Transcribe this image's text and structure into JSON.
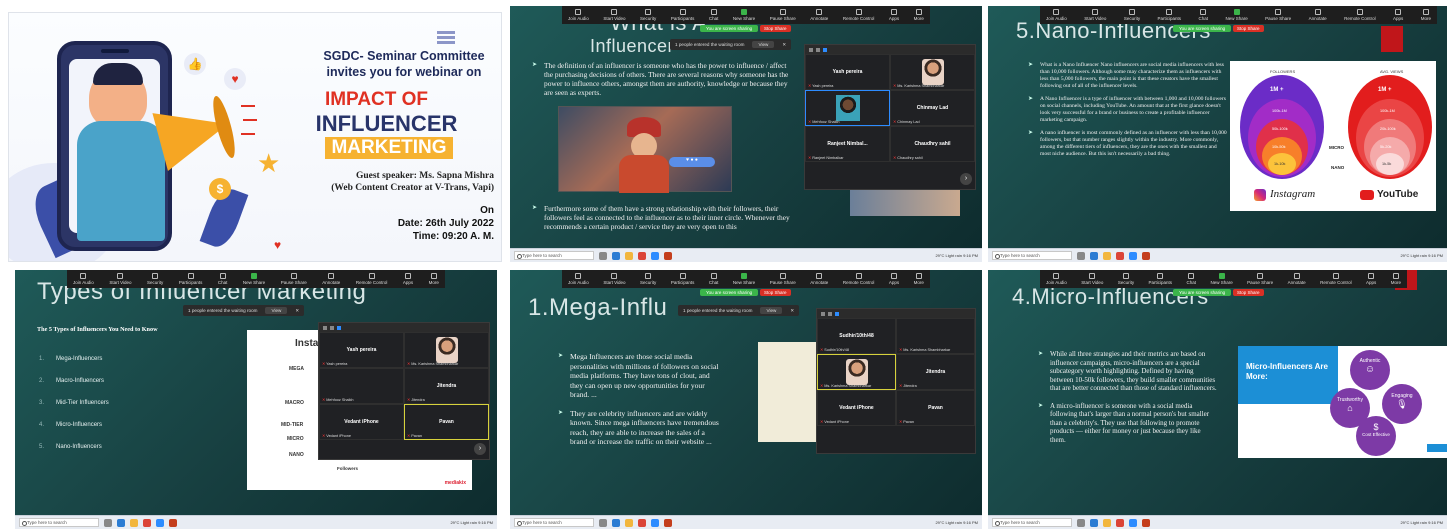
{
  "poster": {
    "line1": "SGDC- Seminar Committee",
    "line2": "invites you for webinar on",
    "title1": "IMPACT OF",
    "title2": "INFLUENCER",
    "title3": "MARKETING",
    "speaker": "Guest speaker:  Ms. Sapna Mishra",
    "speaker_role": "(Web Content Creator at V-Trans, Vapi)",
    "on_label": "On",
    "date": "Date: 26th July 2022",
    "time": "Time: 09:20 A. M."
  },
  "zoom_toolbar": {
    "items": [
      "Join Audio",
      "Start Video",
      "Security",
      "Participants",
      "Chat",
      "New Share",
      "Pause Share",
      "Annotate",
      "Remote Control",
      "Apps",
      "More"
    ],
    "sharing_label": "You are screen sharing",
    "stop_label": "Stop Share"
  },
  "waiting_room": {
    "text": "1 people entered the waiting room",
    "view": "View"
  },
  "taskbar": {
    "search": "Type here to search",
    "weather": "29°C  Light rain",
    "time": "9:16 PM",
    "date": "7/26/2022",
    "lang": "ENG\nIN"
  },
  "slide2": {
    "title": "What is A",
    "title_b": "Influencer",
    "b1": "The definition of an influencer is someone who has the power to influence / affect the purchasing decisions of others. There are several reasons why someone has the power to influence others, amongst them are authority, knowledge or because they are seen as experts.",
    "b2": "Furthermore some of them have a strong relationship with their followers, their followers feel as connected to the influencer as to their inner circle. Whenever they recommends a certain product / service they are very open to this",
    "participants": [
      {
        "name": "Yash pereira",
        "sub": "Yash pereira"
      },
      {
        "name": "",
        "sub": "Ms. Karishma Shambharkar"
      },
      {
        "name": "",
        "sub": "Mehfooz Shaikh"
      },
      {
        "name": "Chinmay  Lad",
        "sub": "Chinmay  Lad"
      },
      {
        "name": "Ranjeet  Nimbal...",
        "sub": "Ranjeet Nimbalkar"
      },
      {
        "name": "Chaudhry sahil",
        "sub": "Chaudhry sahil"
      }
    ]
  },
  "slide3": {
    "title": "5.Nano-Influencers",
    "b1": "What is a Nano Influencer Nano influencers are social media influencers with less than 10,000 followers. Although some may characterize them as influencers with less than 5,000 followers, the main point is that these creators have the smallest following out of all of the influencer levels.",
    "b2": "A Nano Influencer is a type of influencer with between 1,000 and 10,000 followers on social channels, including YouTube. An amount that at the first glance doesn't look very successful for a brand or business to create a profitable influencer marketing campaign.",
    "b3": "A nano influencer is most commonly defined as an influencer with less than 10,000 followers, but that number ranges slightly within the industry. More commonly, among the different tiers of influencers, they are the ones with the smallest and most niche audience. But this isn't necessarily a bad thing.",
    "followers_label": "FOLLOWERS",
    "views_label": "AVG. VIEWS",
    "rings_left": [
      "1M +",
      "100k-1M",
      "50k-100k",
      "10k-50k",
      "1k-10k"
    ],
    "rings_right": [
      "1M +",
      "100k-1M",
      "20k-100k",
      "5k-20k",
      "1k-5k"
    ],
    "micro": "MICRO",
    "nano": "NANO",
    "instagram": "Instagram",
    "youtube": "YouTube"
  },
  "slide4": {
    "title": "Types of Influencer Marketing",
    "heading": "The 5 Types of Influencers You Need to Know",
    "items": [
      "Mega-Influencers",
      "Macro-Influencers",
      "Mid-Tier Influencers",
      "Micro-Influencers",
      "Nano-Influencers"
    ],
    "card_title": "Insta",
    "card_labels": [
      "MEGA",
      "MACRO",
      "MID-TIER",
      "MICRO",
      "NANO"
    ],
    "card_foot": "Followers",
    "card_brand": "mediakix",
    "participants": [
      {
        "name": "Yash pereira",
        "sub": "Yash pereira"
      },
      {
        "name": "",
        "sub": "Ms. Karishma Shambharkar"
      },
      {
        "name": "",
        "sub": "Mehfooz Shaikh"
      },
      {
        "name": "Jitendra",
        "sub": "Jitendra"
      },
      {
        "name": "Vedant iPhone",
        "sub": "Vedant iPhone"
      },
      {
        "name": "Pavan",
        "sub": "Pavan"
      }
    ]
  },
  "slide5": {
    "title": "1.Mega-Influ",
    "b1": "Mega Influencers are those social media personalities with millions of followers on social media platforms. They have tons of clout, and they can open up new opportunities for your brand. ...",
    "b2": "They are celebrity influencers and are widely known. Since mega influencers have tremendous reach, they are able to increase the sales of a brand or increase the traffic on their website ...",
    "participants": [
      {
        "name": "Sudhir/10th/48",
        "sub": "Sudhir/10th/48"
      },
      {
        "name": "",
        "sub": "Ms. Karishma Shambharkar"
      },
      {
        "name": "",
        "sub": "Ms. Karishma Shambharkar"
      },
      {
        "name": "Jitendra",
        "sub": "Jitendra"
      },
      {
        "name": "Vedant iPhone",
        "sub": "Vedant iPhone"
      },
      {
        "name": "Pavan",
        "sub": "Pavan"
      }
    ]
  },
  "slide6": {
    "title": "4.Micro-Influencers",
    "b1": "While all three strategies and their metrics are based on influencer campaigns, micro-influencers are a special subcategory worth highlighting. Defined by having between 10-50k followers, they build smaller communities that are better connected than those of standard influencers.",
    "b2": "A micro-influencer is someone with a social media following that's larger than a normal person's but smaller than a celebrity's. They use that following to promote products — either for money or just because they like them.",
    "card_title": "Micro-Influencers Are More:",
    "nodes": [
      "Authentic",
      "Trustworthy",
      "Engaging",
      "Cost Effective"
    ]
  }
}
